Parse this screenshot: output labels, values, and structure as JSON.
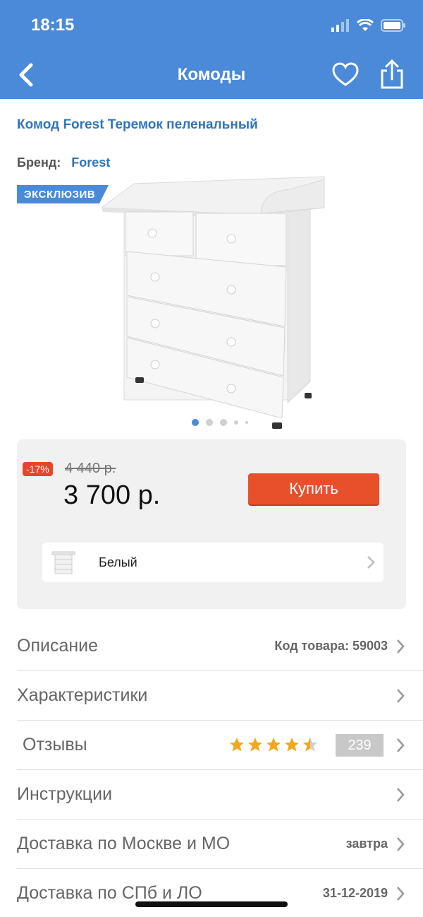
{
  "status_bar": {
    "time": "18:15"
  },
  "nav": {
    "title": "Комоды",
    "icons": [
      "back-icon",
      "heart-icon",
      "share-icon"
    ]
  },
  "product": {
    "title": "Комод Forest Теремок пеленальный",
    "brand_label": "Бренд:",
    "brand_value": "Forest",
    "badge": "ЭКСКЛЮЗИВ",
    "gallery": {
      "total_images": 5,
      "active_index": 0
    }
  },
  "price": {
    "discount": "-17%",
    "old_price": "4 440 р.",
    "new_price": "3 700 р.",
    "buy_label": "Купить",
    "variant_label": "Белый"
  },
  "menu": {
    "description": {
      "label": "Описание",
      "value": "Код товара: 59003"
    },
    "specs": {
      "label": "Характеристики"
    },
    "reviews": {
      "label": "Отзывы",
      "rating": 4.5,
      "count": "239"
    },
    "instructions": {
      "label": "Инструкции"
    },
    "delivery_msk": {
      "label": "Доставка по Москве и МО",
      "value": "завтра"
    },
    "delivery_spb": {
      "label": "Доставка по СПб и ЛО",
      "value": "31-12-2019"
    }
  },
  "colors": {
    "brand_blue": "#4a8ad8",
    "link_blue": "#2f74c0",
    "buy_orange": "#e8502c",
    "discount_red": "#e8452c",
    "star_gold": "#f0a81c"
  }
}
